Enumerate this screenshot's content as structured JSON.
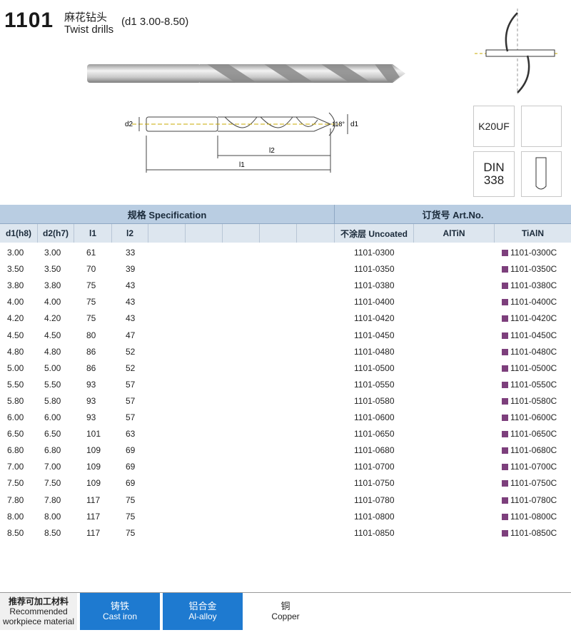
{
  "header": {
    "code": "1101",
    "name_cn": "麻花钻头",
    "name_en": "Twist drills",
    "range": "(d1  3.00-8.50)"
  },
  "drawing": {
    "label_d2": "d2",
    "label_d1": "d1",
    "label_l2": "l2",
    "label_l1": "l1",
    "angle": "118°"
  },
  "side": {
    "grade": "K20UF",
    "standard_line1": "DIN",
    "standard_line2": "338"
  },
  "table": {
    "spec_header": "规格 Specification",
    "artno_header": "订货号 Art.No.",
    "columns": [
      "d1(h8)",
      "d2(h7)",
      "l1",
      "l2",
      "不涂层 Uncoated",
      "AlTiN",
      "TiAlN"
    ],
    "rows": [
      [
        "3.00",
        "3.00",
        "61",
        "33",
        "1101-0300",
        "",
        "1101-0300C"
      ],
      [
        "3.50",
        "3.50",
        "70",
        "39",
        "1101-0350",
        "",
        "1101-0350C"
      ],
      [
        "3.80",
        "3.80",
        "75",
        "43",
        "1101-0380",
        "",
        "1101-0380C"
      ],
      [
        "4.00",
        "4.00",
        "75",
        "43",
        "1101-0400",
        "",
        "1101-0400C"
      ],
      [
        "4.20",
        "4.20",
        "75",
        "43",
        "1101-0420",
        "",
        "1101-0420C"
      ],
      [
        "4.50",
        "4.50",
        "80",
        "47",
        "1101-0450",
        "",
        "1101-0450C"
      ],
      [
        "4.80",
        "4.80",
        "86",
        "52",
        "1101-0480",
        "",
        "1101-0480C"
      ],
      [
        "5.00",
        "5.00",
        "86",
        "52",
        "1101-0500",
        "",
        "1101-0500C"
      ],
      [
        "5.50",
        "5.50",
        "93",
        "57",
        "1101-0550",
        "",
        "1101-0550C"
      ],
      [
        "5.80",
        "5.80",
        "93",
        "57",
        "1101-0580",
        "",
        "1101-0580C"
      ],
      [
        "6.00",
        "6.00",
        "93",
        "57",
        "1101-0600",
        "",
        "1101-0600C"
      ],
      [
        "6.50",
        "6.50",
        "101",
        "63",
        "1101-0650",
        "",
        "1101-0650C"
      ],
      [
        "6.80",
        "6.80",
        "109",
        "69",
        "1101-0680",
        "",
        "1101-0680C"
      ],
      [
        "7.00",
        "7.00",
        "109",
        "69",
        "1101-0700",
        "",
        "1101-0700C"
      ],
      [
        "7.50",
        "7.50",
        "109",
        "69",
        "1101-0750",
        "",
        "1101-0750C"
      ],
      [
        "7.80",
        "7.80",
        "117",
        "75",
        "1101-0780",
        "",
        "1101-0780C"
      ],
      [
        "8.00",
        "8.00",
        "117",
        "75",
        "1101-0800",
        "",
        "1101-0800C"
      ],
      [
        "8.50",
        "8.50",
        "117",
        "75",
        "1101-0850",
        "",
        "1101-0850C"
      ]
    ]
  },
  "materials": {
    "label_cn": "推荐可加工材料",
    "label_en1": "Recommended",
    "label_en2": "workpiece material",
    "items": [
      {
        "cn": "铸铁",
        "en": "Cast iron",
        "highlight": true
      },
      {
        "cn": "铝合金",
        "en": "Al-alloy",
        "highlight": true
      },
      {
        "cn": "铜",
        "en": "Copper",
        "highlight": false
      }
    ]
  },
  "colors": {
    "header_blue": "#b9cde2",
    "subheader_blue": "#dde6ef",
    "material_blue": "#1e7ad0",
    "coating_marker": "#7d3f7c"
  }
}
